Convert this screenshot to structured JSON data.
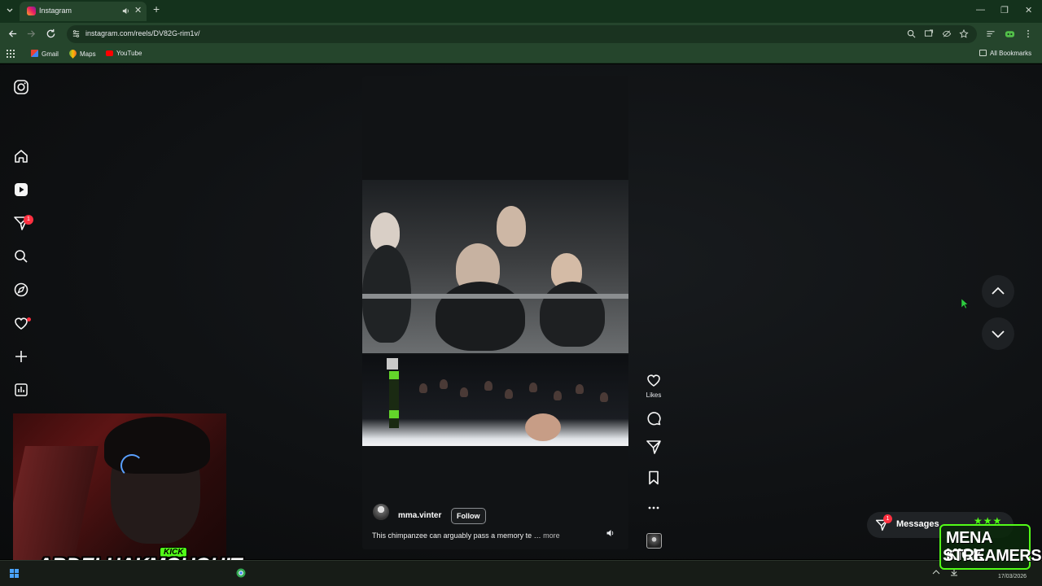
{
  "browser": {
    "tab_title": "Instagram",
    "url": "instagram.com/reels/DV82G-rim1v/",
    "bookmarks": [
      "Gmail",
      "Maps",
      "YouTube"
    ],
    "all_bookmarks_label": "All Bookmarks"
  },
  "sidebar": {
    "notifications_badge": "1",
    "items": [
      "instagram-logo",
      "home",
      "reels",
      "messages",
      "search",
      "explore",
      "notifications",
      "create",
      "dashboard"
    ]
  },
  "reel": {
    "username": "mma.vinter",
    "follow_label": "Follow",
    "caption": "This chimpanzee can arguably pass a memory te",
    "more_label": "more",
    "likes_label": "Likes"
  },
  "messages": {
    "label": "Messages",
    "badge": "1"
  },
  "overlay": {
    "kick_tag": "KICK",
    "streamer_name": "ABDELHAKMOUGHIT",
    "mena_line1": "MENA KICK",
    "mena_line2": "STREAMERS",
    "stars": "★★★"
  },
  "taskbar": {
    "date": "17/03/2026"
  },
  "colors": {
    "chrome_bg": "#25452c",
    "badge_red": "#ff3040",
    "kick_green": "#53fc18"
  }
}
